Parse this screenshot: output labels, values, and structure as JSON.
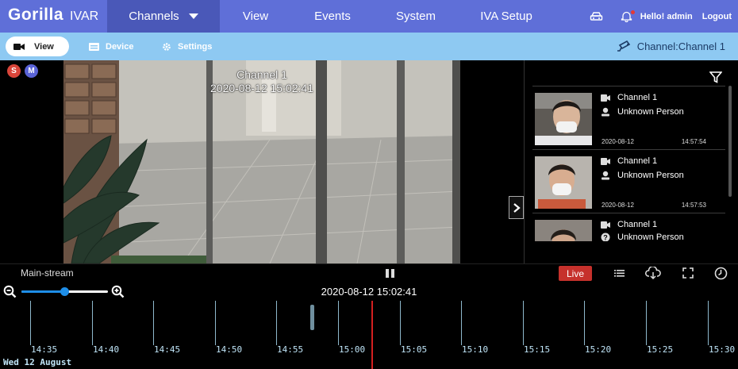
{
  "brand": {
    "name": "Gorilla",
    "product": "IVAR"
  },
  "nav": {
    "items": [
      {
        "label": "Channels",
        "active": true
      },
      {
        "label": "View"
      },
      {
        "label": "Events"
      },
      {
        "label": "System"
      },
      {
        "label": "IVA Setup"
      }
    ],
    "greeting": "Hello! admin",
    "logout": "Logout"
  },
  "subnav": {
    "tabs": [
      {
        "label": "View",
        "icon": "camera-icon",
        "active": true
      },
      {
        "label": "Device",
        "icon": "device-icon"
      },
      {
        "label": "Settings",
        "icon": "gear-icon"
      }
    ],
    "channel": "Channel:Channel 1"
  },
  "video": {
    "badges": [
      {
        "label": "S",
        "color": "#d9453a"
      },
      {
        "label": "M",
        "color": "#5a63d6"
      }
    ],
    "osd_channel": "Channel 1",
    "osd_timestamp": "2020-08-12 15:02:41"
  },
  "events": [
    {
      "channel": "Channel 1",
      "label": "Unknown Person",
      "date": "2020-08-12",
      "time": "14:57:54"
    },
    {
      "channel": "Channel 1",
      "label": "Unknown Person",
      "date": "2020-08-12",
      "time": "14:57:53"
    },
    {
      "channel": "Channel 1",
      "label": "Unknown Person"
    }
  ],
  "controls": {
    "stream": "Main-stream",
    "live": "Live",
    "live_color": "#c6312c",
    "zoom_level": 0.5
  },
  "timeline": {
    "current_time": "2020-08-12 15:02:41",
    "date_label": "Wed 12 August",
    "ticks": [
      "14:35",
      "14:40",
      "14:45",
      "14:50",
      "14:55",
      "15:00",
      "15:05",
      "15:10",
      "15:15",
      "15:20",
      "15:25",
      "15:30"
    ],
    "cursor_color": "#d42020"
  }
}
